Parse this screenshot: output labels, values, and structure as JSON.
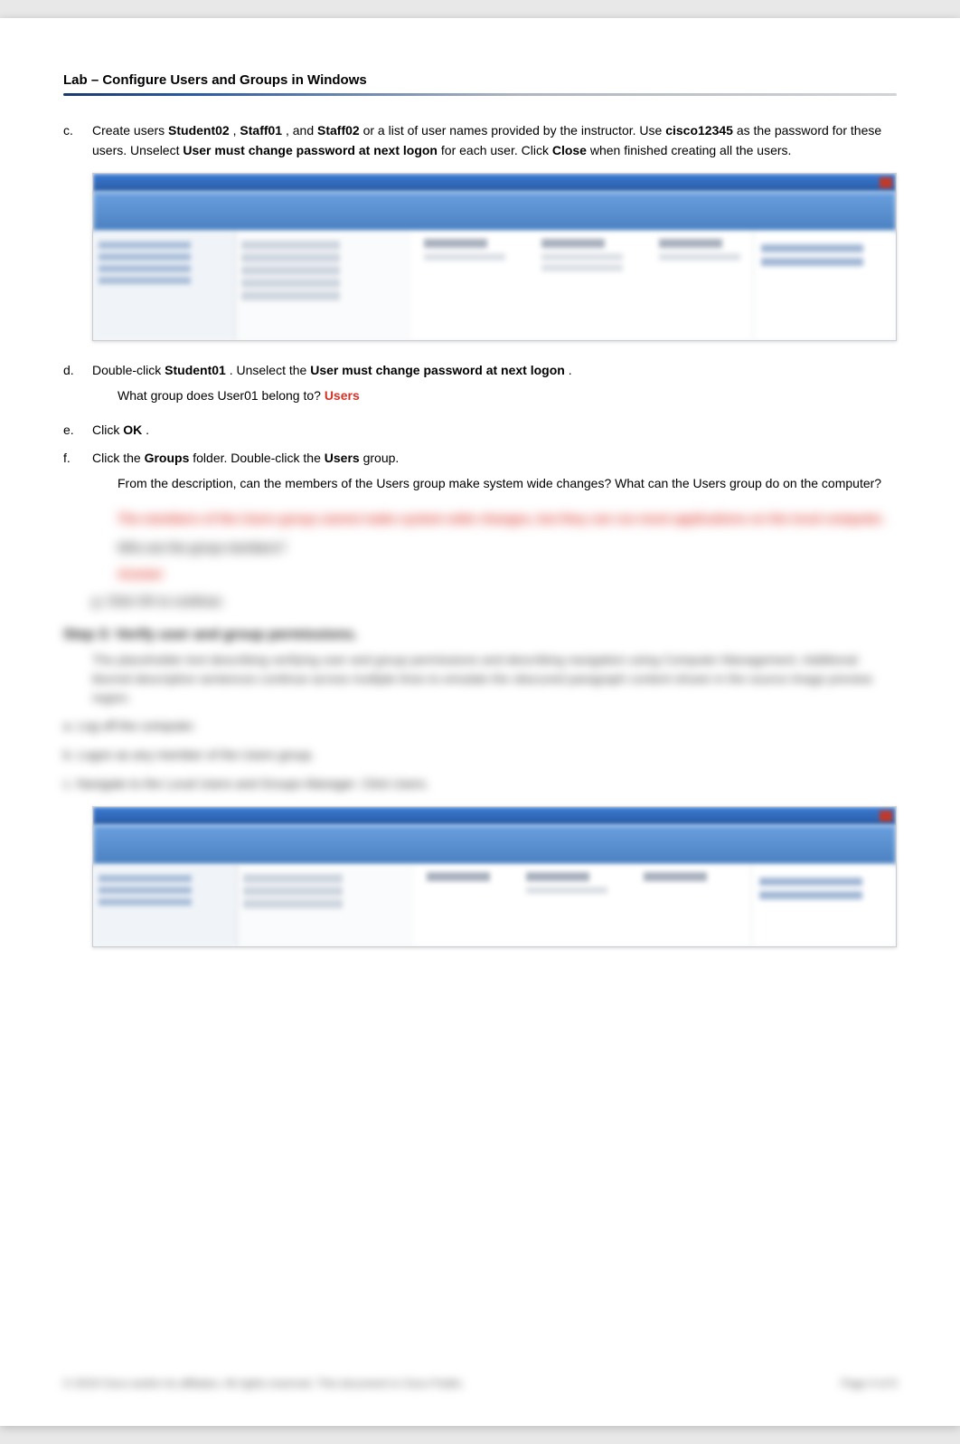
{
  "header": {
    "title": "Lab – Configure Users and Groups in Windows"
  },
  "steps": {
    "c": {
      "marker": "c.",
      "text_before": "Create users ",
      "u1": "Student02",
      "sep1": ", ",
      "u2": "Staff01",
      "sep2": ", and ",
      "u3": "Staff02",
      "text_mid1": " or a list of user names provided by the instructor. Use ",
      "pw": "cisco12345",
      "text_mid2": " as the password for these users. Unselect ",
      "opt": "User must change password at next logon",
      "text_mid3": " for each user. Click ",
      "close": "Close",
      "text_end": " when finished creating all the users."
    },
    "d": {
      "marker": "d.",
      "t1": "Double-click ",
      "s01": "Student01",
      "t2": ". Unselect the ",
      "opt": "User must change password at next logon",
      "t3": ".",
      "question": "What group does User01 belong to? ",
      "answer": "Users"
    },
    "e": {
      "marker": "e.",
      "t1": "Click ",
      "ok": "OK",
      "t2": "."
    },
    "f": {
      "marker": "f.",
      "t1": "Click the ",
      "groups": "Groups",
      "t2": " folder. Double-click the ",
      "users": "Users",
      "t3": " group.",
      "question": "From the description, can the members of the Users group make system wide changes? What can the Users group do on the computer?"
    }
  },
  "obscured": {
    "answer_block": "The members of the Users group cannot make system wide changes, but they can run most applications on the local computer.",
    "q2": "Who are the group members?",
    "a2": "Answer",
    "g": "g.   Click OK to continue.",
    "step_title": "Step 3: Verify user and group permissions.",
    "para": "The placeholder text describing verifying user and group permissions and describing navigation using Computer Management. Additional blurred descriptive sentences continue across multiple lines to emulate the obscured paragraph content shown in the source image preview region.",
    "li_a": "a.   Log off the computer.",
    "li_b": "b.   Logon as any member of the Users group.",
    "li_c": "c.   Navigate to the Local Users and Groups Manager. Click Users."
  },
  "footer": {
    "left": "© 2019 Cisco and/or its affiliates. All rights reserved. This document is Cisco Public.",
    "right": "Page 4 of 9"
  }
}
